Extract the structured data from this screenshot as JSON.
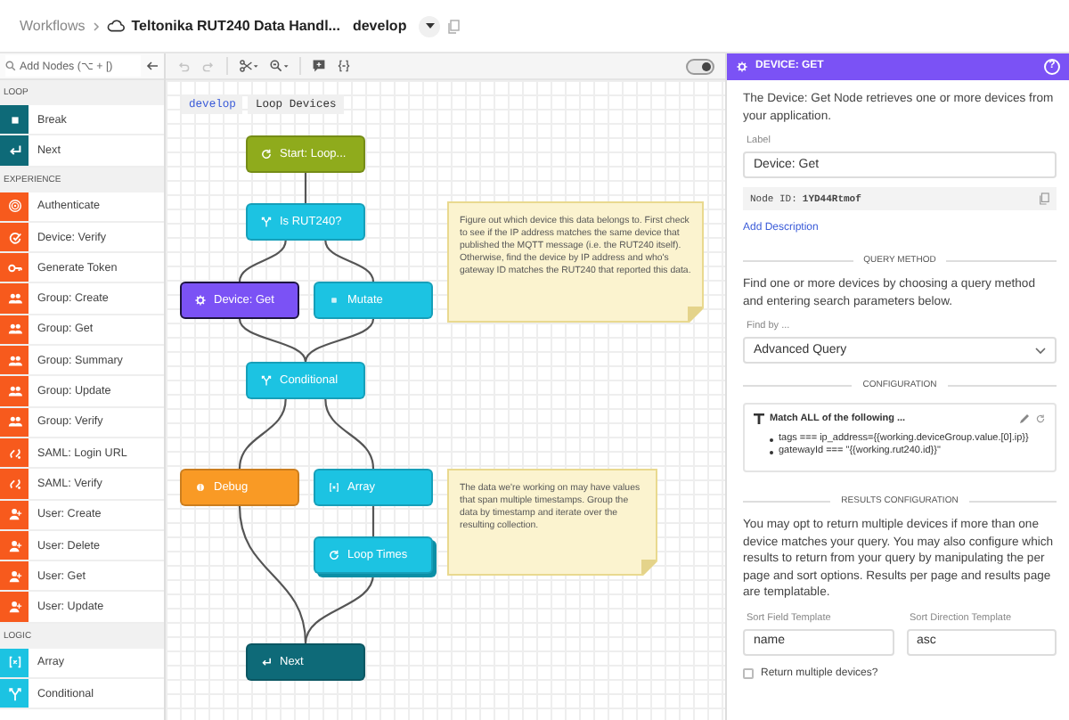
{
  "breadcrumb": {
    "root": "Workflows",
    "title": "Teltonika RUT240 Data Handl...",
    "version": "develop"
  },
  "sidebar": {
    "search": {
      "placeholder": "Add Nodes (⌥ + [)"
    },
    "sections": [
      {
        "title": "LOOP",
        "color": "#0e6a78",
        "items": [
          {
            "label": "Break",
            "kind": "stop"
          },
          {
            "label": "Next",
            "kind": "return"
          }
        ]
      },
      {
        "title": "EXPERIENCE",
        "color": "#f75a1d",
        "items": [
          {
            "label": "Authenticate",
            "kind": "target"
          },
          {
            "label": "Device: Verify",
            "kind": "check"
          },
          {
            "label": "Generate Token",
            "kind": "key"
          },
          {
            "label": "Group: Create",
            "kind": "users"
          },
          {
            "label": "Group: Get",
            "kind": "users"
          },
          {
            "label": "Group: Summary",
            "kind": "users"
          },
          {
            "label": "Group: Update",
            "kind": "users"
          },
          {
            "label": "Group: Verify",
            "kind": "users"
          },
          {
            "label": "SAML: Login URL",
            "kind": "link"
          },
          {
            "label": "SAML: Verify",
            "kind": "link"
          },
          {
            "label": "User: Create",
            "kind": "user"
          },
          {
            "label": "User: Delete",
            "kind": "user"
          },
          {
            "label": "User: Get",
            "kind": "user"
          },
          {
            "label": "User: Update",
            "kind": "user"
          }
        ]
      },
      {
        "title": "LOGIC",
        "color": "#1cc3e2",
        "items": [
          {
            "label": "Array",
            "kind": "array"
          },
          {
            "label": "Conditional",
            "kind": "branch"
          }
        ]
      }
    ]
  },
  "canvas": {
    "toolbar": [
      {
        "kind": "undo",
        "disabled": true
      },
      {
        "kind": "redo",
        "disabled": true
      },
      {
        "kind": "scissors",
        "disabled": false
      },
      {
        "kind": "zoom",
        "disabled": false
      },
      {
        "kind": "comment",
        "disabled": false
      },
      {
        "kind": "code",
        "disabled": false
      }
    ],
    "toggle": {
      "on": true
    },
    "tabs": [
      {
        "label": "develop",
        "selected": true
      },
      {
        "label": "Loop Devices",
        "selected": false
      }
    ],
    "nodes": [
      {
        "label": "Start: Loop...",
        "kind": "loop",
        "color": "#8fab1c",
        "selected": false,
        "stacked": false
      },
      {
        "label": "Is RUT240?",
        "kind": "branch",
        "color": "#1cc3e2",
        "selected": false,
        "stacked": false
      },
      {
        "label": "Device: Get",
        "kind": "device",
        "color": "#7b52f5",
        "selected": true,
        "stacked": false
      },
      {
        "label": "Mutate",
        "kind": "square",
        "color": "#1cc3e2",
        "selected": false,
        "stacked": false
      },
      {
        "label": "Conditional",
        "kind": "branch",
        "color": "#1cc3e2",
        "selected": false,
        "stacked": false
      },
      {
        "label": "Debug",
        "kind": "debug",
        "color": "#f99a25",
        "selected": false,
        "stacked": false
      },
      {
        "label": "Array",
        "kind": "array",
        "color": "#1cc3e2",
        "selected": false,
        "stacked": false
      },
      {
        "label": "Loop Times",
        "kind": "loop",
        "color": "#1cc3e2",
        "selected": false,
        "stacked": true
      },
      {
        "label": "Next",
        "kind": "return",
        "color": "#0e6a78",
        "selected": false,
        "stacked": false
      }
    ],
    "notes": [
      "Figure out which device this data belongs to. First check to see if the IP address matches the same device that published the MQTT message (i.e. the RUT240 itself). Otherwise, find the device by IP address and who's gateway ID matches the RUT240 that reported this data.",
      "The data we're working on may have values that span multiple timestamps. Group the data by timestamp and iterate over the resulting collection."
    ]
  },
  "panel": {
    "title": "DEVICE: GET",
    "help": "?",
    "description": "The Device: Get Node retrieves one or more devices from your application.",
    "label_field": {
      "label": "Label",
      "value": "Device: Get"
    },
    "node_id": {
      "label": "Node ID:",
      "value": "1YD44Rtmof"
    },
    "add_description": "Add Description",
    "query_method": {
      "heading": "QUERY METHOD",
      "text": "Find one or more devices by choosing a query method and entering search parameters below.",
      "find_by": {
        "label": "Find by ...",
        "value": "Advanced Query"
      }
    },
    "configuration": {
      "heading": "CONFIGURATION",
      "filter_title": "Match ALL of the following ...",
      "conditions": [
        "tags === ip_address={{working.deviceGroup.value.[0].ip}}",
        "gatewayId === \"{{working.rut240.id}}\""
      ]
    },
    "results": {
      "heading": "RESULTS CONFIGURATION",
      "text": "You may opt to return multiple devices if more than one device matches your query. You may also configure which results to return from your query by manipulating the per page and sort options. Results per page and results page are templatable.",
      "fields": [
        {
          "label": "Sort Field Template",
          "value": "name"
        },
        {
          "label": "Sort Direction Template",
          "value": "asc"
        }
      ],
      "checkbox": {
        "label": "Return multiple devices?",
        "checked": false
      }
    }
  }
}
